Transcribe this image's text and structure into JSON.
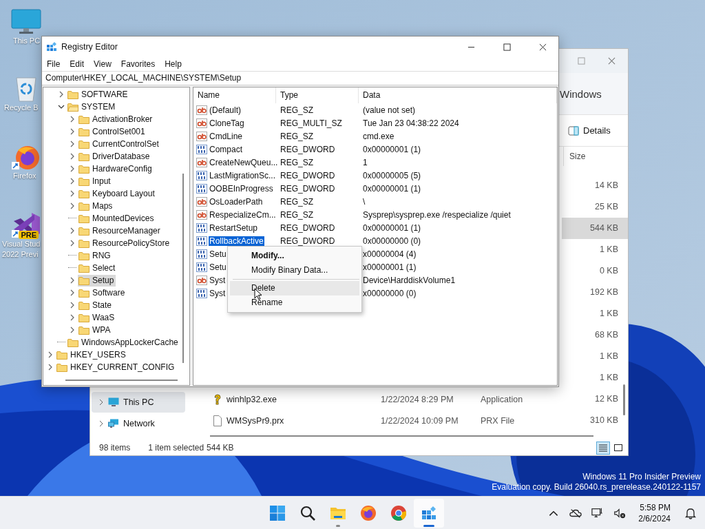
{
  "desktop_icons": [
    {
      "kind": "pc",
      "label_lines": [
        "This PC"
      ]
    },
    {
      "kind": "recycle",
      "label_lines": [
        "Recycle B"
      ]
    },
    {
      "kind": "firefox",
      "shortcut": true,
      "label_lines": [
        "Firefox"
      ]
    },
    {
      "kind": "vs",
      "shortcut": true,
      "badge": "PRE",
      "label_lines": [
        "Visual Stud",
        "2022 Previ"
      ]
    }
  ],
  "explorer": {
    "address_tail": "Windows",
    "toolbar_button": "Details",
    "size_header": "Size",
    "nav": [
      {
        "kind": "pc",
        "label": "This PC",
        "selected": true
      },
      {
        "kind": "network",
        "label": "Network",
        "selected": false
      }
    ],
    "rows": [
      {
        "size": "14 KB",
        "selected": false
      },
      {
        "size": "25 KB",
        "selected": false
      },
      {
        "size": "544 KB",
        "selected": true
      },
      {
        "size": "1 KB",
        "selected": false
      },
      {
        "size": "0 KB",
        "selected": false
      },
      {
        "size": "192 KB",
        "selected": false
      },
      {
        "size": "1 KB",
        "selected": false
      },
      {
        "size": "68 KB",
        "selected": false
      },
      {
        "size": "1 KB",
        "selected": false
      },
      {
        "size": "1 KB",
        "selected": false
      },
      {
        "kind": "help",
        "name": "winhlp32.exe",
        "date": "1/22/2024 8:29 PM",
        "type": "Application",
        "size": "12 KB",
        "selected": false
      },
      {
        "kind": "file",
        "name": "WMSysPr9.prx",
        "date": "1/22/2024 10:09 PM",
        "type": "PRX File",
        "size": "310 KB",
        "selected": false
      }
    ],
    "status": {
      "count": "98 items",
      "selection": "1 item selected",
      "size": "544 KB"
    },
    "views": [
      {
        "kind": "details",
        "selected": true
      },
      {
        "kind": "tiles",
        "selected": false
      }
    ]
  },
  "regedit": {
    "title": "Registry Editor",
    "menu": [
      "File",
      "Edit",
      "View",
      "Favorites",
      "Help"
    ],
    "address": "Computer\\HKEY_LOCAL_MACHINE\\SYSTEM\\Setup",
    "tree": [
      {
        "children": [
          {
            "label": "SOFTWARE",
            "expandable": true,
            "expanded": false,
            "selected": false
          },
          {
            "label": "SYSTEM",
            "expandable": true,
            "expanded": true,
            "selected": false,
            "children": [
              {
                "label": "ActivationBroker",
                "expandable": true,
                "expanded": false,
                "selected": false
              },
              {
                "label": "ControlSet001",
                "expandable": true,
                "expanded": false,
                "selected": false
              },
              {
                "label": "CurrentControlSet",
                "expandable": true,
                "expanded": false,
                "selected": false
              },
              {
                "label": "DriverDatabase",
                "expandable": true,
                "expanded": false,
                "selected": false
              },
              {
                "label": "HardwareConfig",
                "expandable": true,
                "expanded": false,
                "selected": false
              },
              {
                "label": "Input",
                "expandable": true,
                "expanded": false,
                "selected": false
              },
              {
                "label": "Keyboard Layout",
                "expandable": true,
                "expanded": false,
                "selected": false
              },
              {
                "label": "Maps",
                "expandable": true,
                "expanded": false,
                "selected": false
              },
              {
                "label": "MountedDevices",
                "expandable": false,
                "expanded": false,
                "selected": false
              },
              {
                "label": "ResourceManager",
                "expandable": true,
                "expanded": false,
                "selected": false
              },
              {
                "label": "ResourcePolicyStore",
                "expandable": true,
                "expanded": false,
                "selected": false
              },
              {
                "label": "RNG",
                "expandable": false,
                "expanded": false,
                "selected": false
              },
              {
                "label": "Select",
                "expandable": false,
                "expanded": false,
                "selected": false
              },
              {
                "label": "Setup",
                "expandable": true,
                "expanded": false,
                "selected": true
              },
              {
                "label": "Software",
                "expandable": true,
                "expanded": false,
                "selected": false
              },
              {
                "label": "State",
                "expandable": true,
                "expanded": false,
                "selected": false
              },
              {
                "label": "WaaS",
                "expandable": true,
                "expanded": false,
                "selected": false
              },
              {
                "label": "WPA",
                "expandable": true,
                "expanded": false,
                "selected": false
              }
            ]
          },
          {
            "label": "WindowsAppLockerCache",
            "expandable": false,
            "expanded": false,
            "selected": false
          }
        ]
      },
      {
        "label": "HKEY_USERS",
        "expandable": true,
        "expanded": false,
        "selected": false
      },
      {
        "label": "HKEY_CURRENT_CONFIG",
        "expandable": true,
        "expanded": false,
        "selected": false
      }
    ],
    "columns": [
      "Name",
      "Type",
      "Data"
    ],
    "values": [
      {
        "kind": "string",
        "name": "(Default)",
        "type": "REG_SZ",
        "data": "(value not set)",
        "selected": false
      },
      {
        "kind": "string",
        "name": "CloneTag",
        "type": "REG_MULTI_SZ",
        "data": "Tue Jan 23 04:38:22 2024",
        "selected": false
      },
      {
        "kind": "string",
        "name": "CmdLine",
        "type": "REG_SZ",
        "data": "cmd.exe",
        "selected": false
      },
      {
        "kind": "binary",
        "name": "Compact",
        "type": "REG_DWORD",
        "data": "0x00000001 (1)",
        "selected": false
      },
      {
        "kind": "string",
        "name": "CreateNewQueu...",
        "type": "REG_SZ",
        "data": "1",
        "selected": false
      },
      {
        "kind": "binary",
        "name": "LastMigrationSc...",
        "type": "REG_DWORD",
        "data": "0x00000005 (5)",
        "selected": false
      },
      {
        "kind": "binary",
        "name": "OOBEInProgress",
        "type": "REG_DWORD",
        "data": "0x00000001 (1)",
        "selected": false
      },
      {
        "kind": "string",
        "name": "OsLoaderPath",
        "type": "REG_SZ",
        "data": "\\",
        "selected": false
      },
      {
        "kind": "string",
        "name": "RespecializeCm...",
        "type": "REG_SZ",
        "data": "Sysprep\\sysprep.exe /respecialize /quiet",
        "selected": false
      },
      {
        "kind": "binary",
        "name": "RestartSetup",
        "type": "REG_DWORD",
        "data": "0x00000001 (1)",
        "selected": false
      },
      {
        "kind": "binary",
        "name": "RollbackActive",
        "type": "REG_DWORD",
        "data": "0x00000000 (0)",
        "selected": true
      },
      {
        "kind": "binary",
        "name": "Setu",
        "data": "x00000004 (4)",
        "selected": false
      },
      {
        "kind": "binary",
        "name": "Setu",
        "data": "x00000001 (1)",
        "selected": false
      },
      {
        "kind": "string",
        "name": "Syst",
        "data": "Device\\HarddiskVolume1",
        "selected": false
      },
      {
        "kind": "binary",
        "name": "Syst",
        "data": "x00000000 (0)",
        "selected": false
      }
    ]
  },
  "context_menu": [
    {
      "kind": "item",
      "label": "Modify...",
      "default": true,
      "highlighted": false
    },
    {
      "kind": "item",
      "label": "Modify Binary Data...",
      "default": false,
      "highlighted": false
    },
    {
      "kind": "separator"
    },
    {
      "kind": "item",
      "label": "Delete",
      "default": false,
      "highlighted": true
    },
    {
      "kind": "item",
      "label": "Rename",
      "default": false,
      "highlighted": false
    }
  ],
  "watermark": [
    "Windows 11 Pro Insider Preview",
    "Evaluation copy. Build 26040.rs_prerelease.240122-1157"
  ],
  "taskbar": {
    "apps": [
      {
        "kind": "start",
        "running": false,
        "active": false
      },
      {
        "kind": "search",
        "running": false,
        "active": false
      },
      {
        "kind": "explorer",
        "running": true,
        "active": false
      },
      {
        "kind": "firefox",
        "running": false,
        "active": false
      },
      {
        "kind": "chrome",
        "running": false,
        "active": false
      },
      {
        "kind": "regedit",
        "running": true,
        "active": true
      }
    ],
    "time": "5:58 PM",
    "date": "2/6/2024"
  }
}
